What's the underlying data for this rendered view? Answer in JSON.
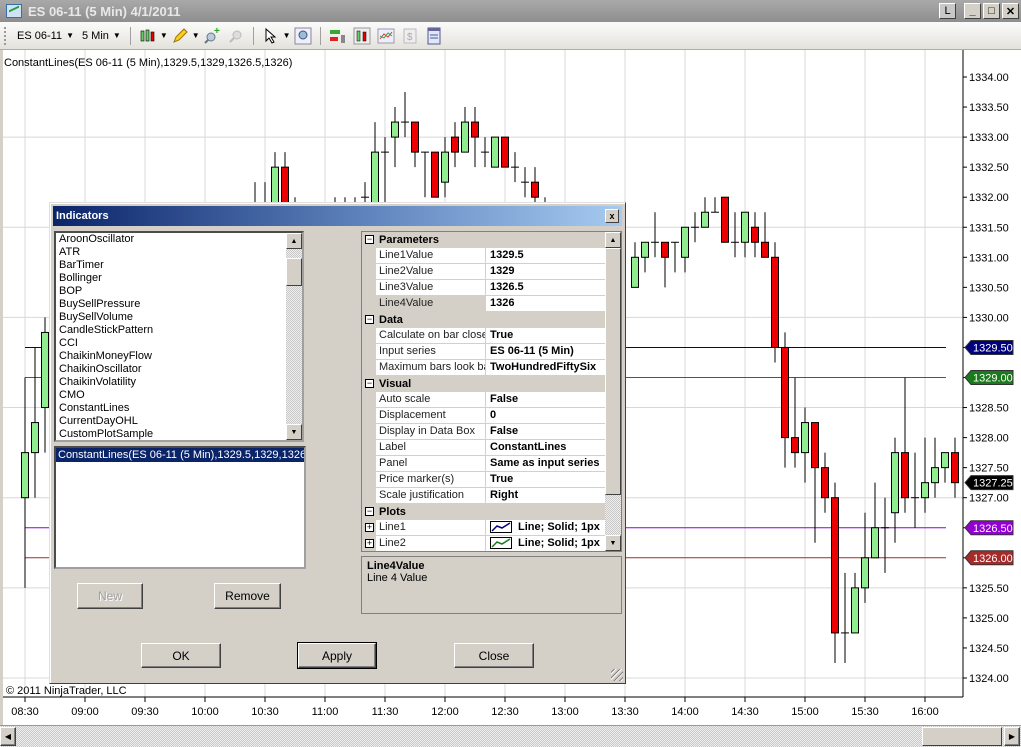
{
  "window": {
    "title": "ES 06-11 (5 Min)  4/1/2011",
    "btn_l": "L",
    "btn_min": "_",
    "btn_max": "□",
    "btn_close": "✕"
  },
  "toolbar": {
    "instrument": "ES 06-11",
    "interval": "5 Min"
  },
  "chart": {
    "indicator_label": "ConstantLines(ES 06-11 (5 Min),1329.5,1329,1326.5,1326)",
    "copyright": "© 2011 NinjaTrader, LLC",
    "last_price": "1327.25"
  },
  "chart_data": {
    "type": "candlestick",
    "price_ticks": [
      "1334.00",
      "1333.50",
      "1333.00",
      "1332.50",
      "1332.00",
      "1331.50",
      "1331.00",
      "1330.50",
      "1330.00",
      "1329.50",
      "1329.00",
      "1328.50",
      "1328.00",
      "1327.50",
      "1327.00",
      "1326.50",
      "1326.00",
      "1325.50",
      "1325.00",
      "1324.50",
      "1324.00"
    ],
    "ylim": [
      1324,
      1334
    ],
    "time_ticks": [
      "08:30",
      "09:00",
      "09:30",
      "10:00",
      "10:30",
      "11:00",
      "11:30",
      "12:00",
      "12:30",
      "13:00",
      "13:30",
      "14:00",
      "14:30",
      "15:00",
      "15:30",
      "16:00"
    ],
    "constant_lines": [
      {
        "value": 1329.5,
        "label": "1329.50",
        "color": "#000080"
      },
      {
        "value": 1329.0,
        "label": "1329.00",
        "color": "#1b7a1b"
      },
      {
        "value": 1326.5,
        "label": "1326.50",
        "color": "#9400d3"
      },
      {
        "value": 1326.0,
        "label": "1326.00",
        "color": "#a52a2a"
      }
    ],
    "colors": {
      "up": "#90ee90",
      "down": "#ee0000",
      "outline": "#000000"
    },
    "bars_ohlc": [
      [
        "08:30",
        1327,
        1329,
        1325.5,
        1327.75
      ],
      [
        "08:35",
        1327.75,
        1329.5,
        1327,
        1328.25
      ],
      [
        "08:40",
        1328.5,
        1330,
        1327.75,
        1329.75
      ],
      [
        "10:25",
        1331.5,
        1332.25,
        1331.25,
        1331.75
      ],
      [
        "10:30",
        1331.5,
        1332.25,
        1331,
        1331.5
      ],
      [
        "10:35",
        1331.5,
        1332.75,
        1331.25,
        1332.5
      ],
      [
        "10:40",
        1332.5,
        1332.75,
        1331.25,
        1331.5
      ],
      [
        "10:45",
        1331.75,
        1332,
        1331.25,
        1331.5
      ],
      [
        "11:05",
        1331.5,
        1332,
        1331.25,
        1331.5
      ],
      [
        "11:10",
        1331.5,
        1332,
        1331.25,
        1331.5
      ],
      [
        "11:15",
        1331.5,
        1332,
        1331.25,
        1331.5
      ],
      [
        "11:20",
        1332,
        1332.25,
        1331.25,
        1332
      ],
      [
        "11:25",
        1331.5,
        1333.25,
        1331.25,
        1332.75
      ],
      [
        "11:30",
        1332.75,
        1333,
        1331.5,
        1332.75
      ],
      [
        "11:35",
        1333,
        1333.5,
        1332.5,
        1333.25
      ],
      [
        "11:40",
        1333.25,
        1333.75,
        1333,
        1333.25
      ],
      [
        "11:45",
        1333.25,
        1333.25,
        1332.5,
        1332.75
      ],
      [
        "11:50",
        1332.75,
        1332.75,
        1332,
        1332.75
      ],
      [
        "11:55",
        1332.75,
        1332.75,
        1332,
        1332
      ],
      [
        "12:00",
        1332.25,
        1333,
        1332,
        1332.75
      ],
      [
        "12:05",
        1333,
        1333.25,
        1332.5,
        1332.75
      ],
      [
        "12:10",
        1332.75,
        1333.5,
        1332.75,
        1333.25
      ],
      [
        "12:15",
        1333.25,
        1333.5,
        1332.5,
        1333
      ],
      [
        "12:20",
        1332.75,
        1333,
        1332.5,
        1332.75
      ],
      [
        "12:25",
        1332.5,
        1333,
        1332.5,
        1333
      ],
      [
        "12:30",
        1333,
        1333,
        1332.5,
        1332.5
      ],
      [
        "12:35",
        1332.5,
        1332.75,
        1332.25,
        1332.5
      ],
      [
        "12:40",
        1332.25,
        1332.5,
        1332,
        1332.25
      ],
      [
        "12:45",
        1332.25,
        1332.5,
        1331.75,
        1332
      ],
      [
        "12:50",
        1331.75,
        1332,
        1331.5,
        1331.75
      ],
      [
        "13:35",
        1330.5,
        1331.25,
        1330.5,
        1331
      ],
      [
        "13:40",
        1331,
        1331.25,
        1330.75,
        1331.25
      ],
      [
        "13:45",
        1331.25,
        1331.75,
        1331,
        1331.25
      ],
      [
        "13:50",
        1331.25,
        1331.25,
        1330.5,
        1331
      ],
      [
        "13:55",
        1331.25,
        1331.25,
        1330.75,
        1331.25
      ],
      [
        "14:00",
        1331,
        1331.5,
        1330.75,
        1331.5
      ],
      [
        "14:05",
        1331.5,
        1331.75,
        1331.25,
        1331.5
      ],
      [
        "14:10",
        1331.5,
        1332,
        1331.5,
        1331.75
      ],
      [
        "14:15",
        1331.75,
        1332,
        1331.75,
        1331.75
      ],
      [
        "14:20",
        1332,
        1332,
        1331.25,
        1331.25
      ],
      [
        "14:25",
        1331.25,
        1331.75,
        1331,
        1331.25
      ],
      [
        "14:30",
        1331.25,
        1331.75,
        1331,
        1331.75
      ],
      [
        "14:35",
        1331.5,
        1331.75,
        1331,
        1331.25
      ],
      [
        "14:40",
        1331.25,
        1331.75,
        1331,
        1331
      ],
      [
        "14:45",
        1331,
        1331.25,
        1329.25,
        1329.5
      ],
      [
        "14:50",
        1329.5,
        1329.75,
        1327.5,
        1328
      ],
      [
        "14:55",
        1328,
        1329,
        1327.5,
        1327.75
      ],
      [
        "15:00",
        1327.75,
        1328.5,
        1327.25,
        1328.25
      ],
      [
        "15:05",
        1328.25,
        1328.25,
        1326.25,
        1327.5
      ],
      [
        "15:10",
        1327.5,
        1327.75,
        1326.75,
        1327
      ],
      [
        "15:15",
        1327,
        1327.25,
        1324.25,
        1324.75
      ],
      [
        "15:20",
        1324.75,
        1325.75,
        1324.25,
        1324.75
      ],
      [
        "15:25",
        1324.75,
        1325.75,
        1324.75,
        1325.5
      ],
      [
        "15:30",
        1325.5,
        1326.75,
        1325.25,
        1326
      ],
      [
        "15:35",
        1326,
        1327.25,
        1326,
        1326.5
      ],
      [
        "15:40",
        1326.5,
        1327,
        1325.75,
        1326.5
      ],
      [
        "15:45",
        1326.75,
        1328,
        1326.25,
        1327.75
      ],
      [
        "15:50",
        1327.75,
        1329,
        1326.75,
        1327
      ],
      [
        "15:55",
        1327,
        1327.75,
        1326.5,
        1327
      ],
      [
        "16:00",
        1327,
        1328,
        1326.75,
        1327.25
      ],
      [
        "16:05",
        1327.25,
        1328,
        1327,
        1327.5
      ],
      [
        "16:10",
        1327.5,
        1327.75,
        1327.25,
        1327.75
      ],
      [
        "16:15",
        1327.75,
        1328,
        1327,
        1327.25
      ]
    ]
  },
  "dialog": {
    "title": "Indicators",
    "close": "x",
    "indicators": [
      "AroonOscillator",
      "ATR",
      "BarTimer",
      "Bollinger",
      "BOP",
      "BuySellPressure",
      "BuySellVolume",
      "CandleStickPattern",
      "CCI",
      "ChaikinMoneyFlow",
      "ChaikinOscillator",
      "ChaikinVolatility",
      "CMO",
      "ConstantLines",
      "CurrentDayOHL",
      "CustomPlotSample"
    ],
    "applied": "ConstantLines(ES 06-11 (5 Min),1329.5,1329,1326.5",
    "new_label": "New",
    "remove_label": "Remove",
    "ok_label": "OK",
    "apply_label": "Apply",
    "close_label": "Close",
    "properties": [
      {
        "category": "Parameters"
      },
      {
        "name": "Line1Value",
        "value": "1329.5"
      },
      {
        "name": "Line2Value",
        "value": "1329"
      },
      {
        "name": "Line3Value",
        "value": "1326.5"
      },
      {
        "name": "Line4Value",
        "value": "1326",
        "selected": true
      },
      {
        "category": "Data"
      },
      {
        "name": "Calculate on bar close",
        "value": "True"
      },
      {
        "name": "Input series",
        "value": "ES 06-11 (5 Min)"
      },
      {
        "name": "Maximum bars look back",
        "value": "TwoHundredFiftySix"
      },
      {
        "category": "Visual"
      },
      {
        "name": "Auto scale",
        "value": "False"
      },
      {
        "name": "Displacement",
        "value": "0"
      },
      {
        "name": "Display in Data Box",
        "value": "False"
      },
      {
        "name": "Label",
        "value": "ConstantLines"
      },
      {
        "name": "Panel",
        "value": "Same as input series"
      },
      {
        "name": "Price marker(s)",
        "value": "True"
      },
      {
        "name": "Scale justification",
        "value": "Right"
      },
      {
        "category": "Plots"
      },
      {
        "name": "Line1",
        "value": "Line; Solid; 1px",
        "expand": true,
        "swatch": "#000080"
      },
      {
        "name": "Line2",
        "value": "Line; Solid; 1px",
        "expand": true,
        "swatch": "#1b7a1b"
      }
    ],
    "description_title": "Line4Value",
    "description_text": "Line 4 Value"
  }
}
